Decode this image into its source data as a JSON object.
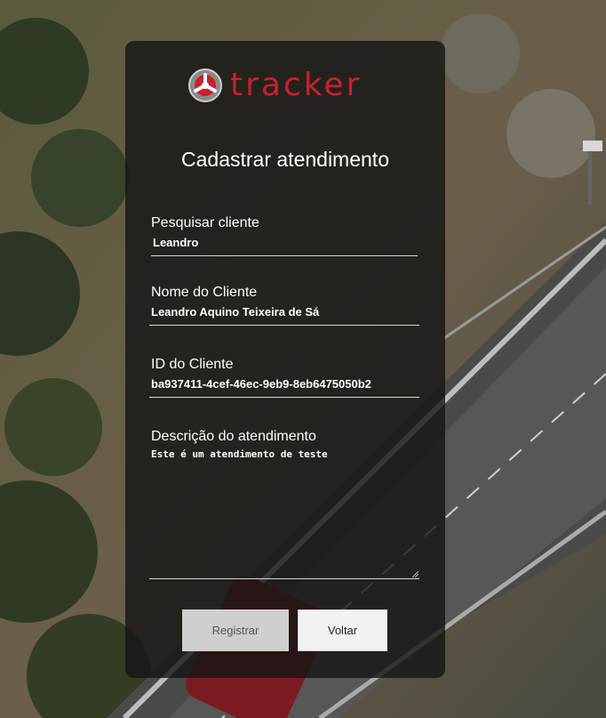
{
  "brand": {
    "logo_text": "tracker",
    "accent_color": "#c8202e"
  },
  "form": {
    "title": "Cadastrar atendimento",
    "fields": [
      {
        "label": "Pesquisar cliente",
        "value": "Leandro"
      },
      {
        "label": "Nome do Cliente",
        "value": "Leandro Aquino Teixeira de Sá"
      },
      {
        "label": "ID do Cliente",
        "value": "ba937411-4cef-46ec-9eb9-8eb6475050b2"
      },
      {
        "label": "Descrição do atendimento",
        "value": "Este é um atendimento de teste"
      }
    ],
    "buttons": {
      "register": "Registrar",
      "back": "Voltar"
    }
  }
}
